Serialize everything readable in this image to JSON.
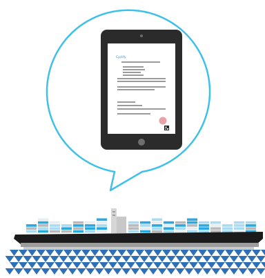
{
  "document": {
    "logo_text": "Cyclify"
  },
  "colors": {
    "bubble_stroke": "#3fc0e8",
    "tablet_body": "#2b2b2b",
    "screen": "#ffffff",
    "text_line": "#9a9a9a",
    "stamp": "#e8a2a8",
    "ship_hull": "#1b1b1b",
    "ship_stripe": "#9c9c9c",
    "water_light": "#ffffff",
    "water_dark": "#2e6fb5",
    "container_blue": "#29a9e0",
    "container_light": "#a9dcf3",
    "container_grey": "#b9b9b9",
    "container_white": "#e6eef2"
  },
  "icons": {
    "qr": "qr-code-icon",
    "camera": "camera-icon",
    "home": "home-button-icon"
  }
}
